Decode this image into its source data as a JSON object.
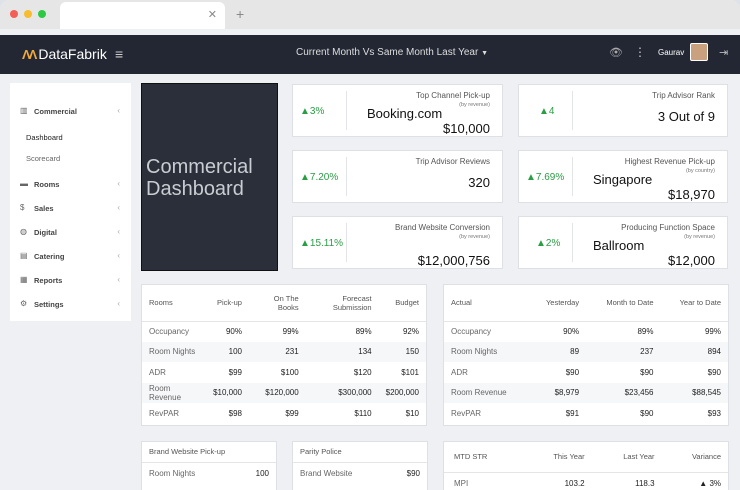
{
  "browser": {
    "close_glyph": "✕",
    "new_tab_glyph": "+"
  },
  "app": {
    "logo_mark": "ɅɅ",
    "brand": "DataFabrik",
    "filter_title": "Current Month Vs Same Month Last Year",
    "user_name": "Gaurav",
    "menu_glyph": "≡",
    "eye_glyph": "👁",
    "more_glyph": "⋮",
    "filter_glyph": "▼",
    "logout_glyph": "⇥"
  },
  "sidebar": [
    {
      "icon": "▥",
      "label": "Commercial",
      "chevron": "‹"
    },
    {
      "label": "Dashboard"
    },
    {
      "label": "Scorecard"
    },
    {
      "icon": "▬",
      "label": "Rooms",
      "chevron": "‹"
    },
    {
      "icon": "$",
      "label": "Sales",
      "chevron": "‹"
    },
    {
      "icon": "◍",
      "label": "Digital",
      "chevron": "‹"
    },
    {
      "icon": "▤",
      "label": "Catering",
      "chevron": "‹"
    },
    {
      "icon": "▦",
      "label": "Reports",
      "chevron": "‹"
    },
    {
      "icon": "⚙",
      "label": "Settings",
      "chevron": "‹"
    }
  ],
  "hero": {
    "line1": "Commercial",
    "line2": "Dashboard"
  },
  "kpis": {
    "top_channel": {
      "title": "Top Channel Pick-up",
      "sub": "(by revenue)",
      "change": "▲3%",
      "name": "Booking.com",
      "value": "$10,000"
    },
    "trip_rank": {
      "title": "Trip Advisor Rank",
      "change": "▲4",
      "value": "3 Out of 9"
    },
    "trip_reviews": {
      "title": "Trip Advisor Reviews",
      "change": "▲7.20%",
      "value": "320"
    },
    "highest_rev": {
      "title": "Highest Revenue Pick-up",
      "sub": "(by country)",
      "change": "▲7.69%",
      "name": "Singapore",
      "value": "$18,970"
    },
    "brand_conv": {
      "title": "Brand Website Conversion",
      "sub": "(by revenue)",
      "change": "▲15.11%",
      "value": "$12,000,756"
    },
    "func_space": {
      "title": "Producing Function Space",
      "sub": "(by revenue)",
      "change": "▲2%",
      "name": "Ballroom",
      "value": "$12,000"
    }
  },
  "rooms_table": {
    "headers": [
      "Rooms",
      "Pick-up",
      "On The Books",
      "Forecast Submission",
      "Budget"
    ],
    "rows": [
      [
        "Occupancy",
        "90%",
        "99%",
        "89%",
        "92%"
      ],
      [
        "Room Nights",
        "100",
        "231",
        "134",
        "150"
      ],
      [
        "ADR",
        "$99",
        "$100",
        "$120",
        "$101"
      ],
      [
        "Room Revenue",
        "$10,000",
        "$120,000",
        "$300,000",
        "$200,000"
      ],
      [
        "RevPAR",
        "$98",
        "$99",
        "$110",
        "$10"
      ]
    ]
  },
  "actual_table": {
    "headers": [
      "Actual",
      "Yesterday",
      "Month to Date",
      "Year to Date"
    ],
    "rows": [
      [
        "Occupancy",
        "90%",
        "89%",
        "99%"
      ],
      [
        "Room Nights",
        "89",
        "237",
        "894"
      ],
      [
        "ADR",
        "$90",
        "$90",
        "$90"
      ],
      [
        "Room Revenue",
        "$8,979",
        "$23,456",
        "$88,545"
      ],
      [
        "RevPAR",
        "$91",
        "$90",
        "$93"
      ]
    ]
  },
  "brand_pickup": {
    "header": "Brand Website Pick-up",
    "rows": [
      [
        "Room Nights",
        "100"
      ]
    ]
  },
  "parity": {
    "header": "Parity Police",
    "rows": [
      [
        "Brand Website",
        "$90"
      ]
    ]
  },
  "str_table": {
    "headers": [
      "MTD STR",
      "This Year",
      "Last Year",
      "Variance"
    ],
    "rows": [
      [
        "MPI",
        "103.2",
        "118.3",
        "▲ 3%"
      ]
    ]
  }
}
